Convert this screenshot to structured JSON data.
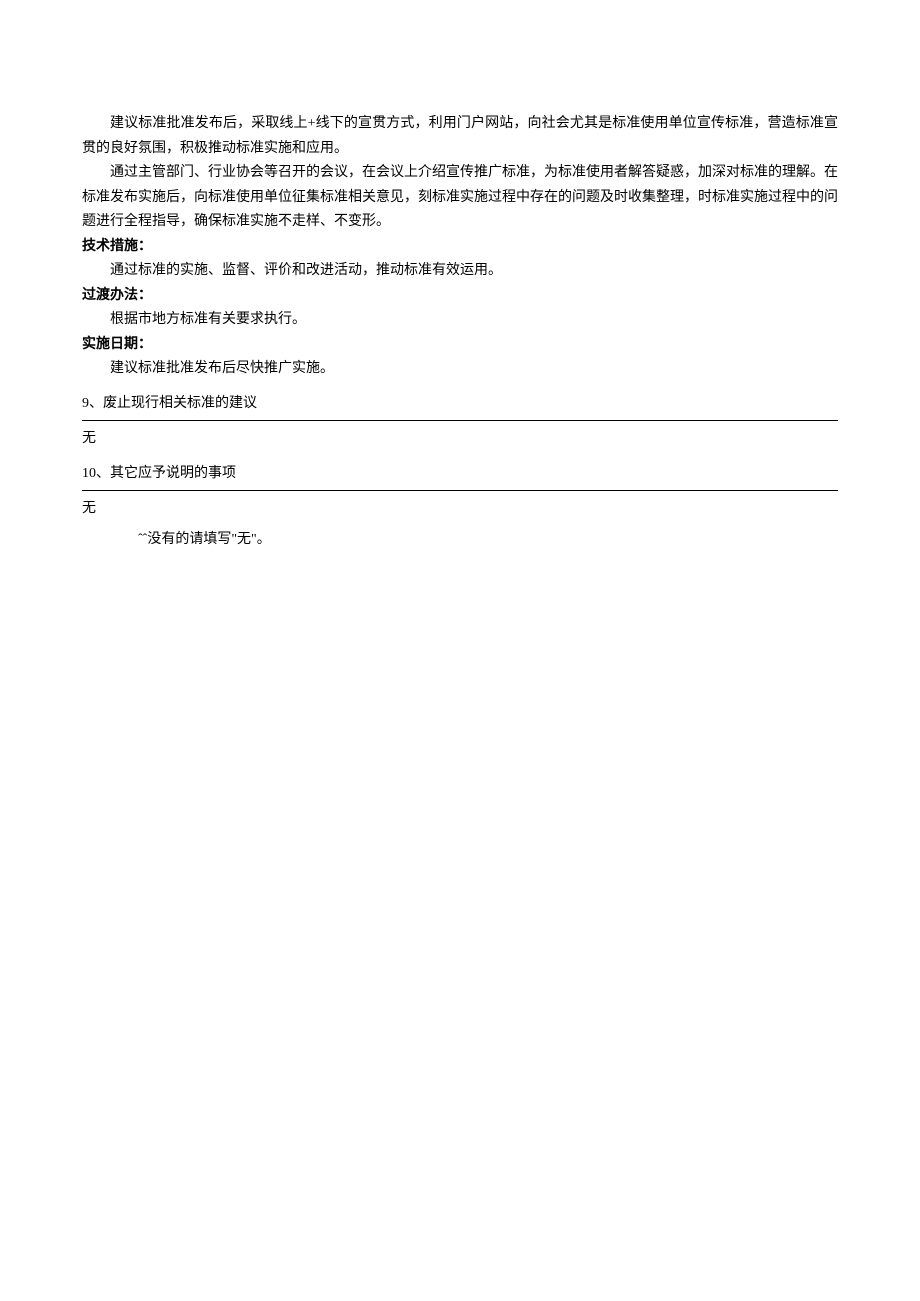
{
  "body": {
    "para1": "建议标准批准发布后，采取线上+线下的宣贯方式，利用门户网站，向社会尤其是标准使用单位宣传标准，营造标准宣贯的良好氛围，积极推动标准实施和应用。",
    "para2": "通过主管部门、行业协会等召开的会议，在会议上介绍宣传推广标准，为标准使用者解答疑惑，加深对标准的理解。在标准发布实施后，向标准使用单位征集标准相关意见，刻标准实施过程中存在的问题及时收集整理，时标准实施过程中的问题进行全程指导，确保标准实施不走样、不变形。",
    "tech_label": "技术措施：",
    "tech_para": "通过标准的实施、监督、评价和改进活动，推动标准有效运用。",
    "trans_label": "过渡办法：",
    "trans_para": "根据市地方标准有关要求执行。",
    "impl_label": "实施日期：",
    "impl_para": "建议标准批准发布后尽快推广实施。"
  },
  "section9": {
    "heading": "9、废止现行相关标准的建议",
    "content": "无"
  },
  "section10": {
    "heading": "10、其它应予说明的事项",
    "content": "无"
  },
  "footnote": "ˆˆ没有的请填写\"无\"。"
}
